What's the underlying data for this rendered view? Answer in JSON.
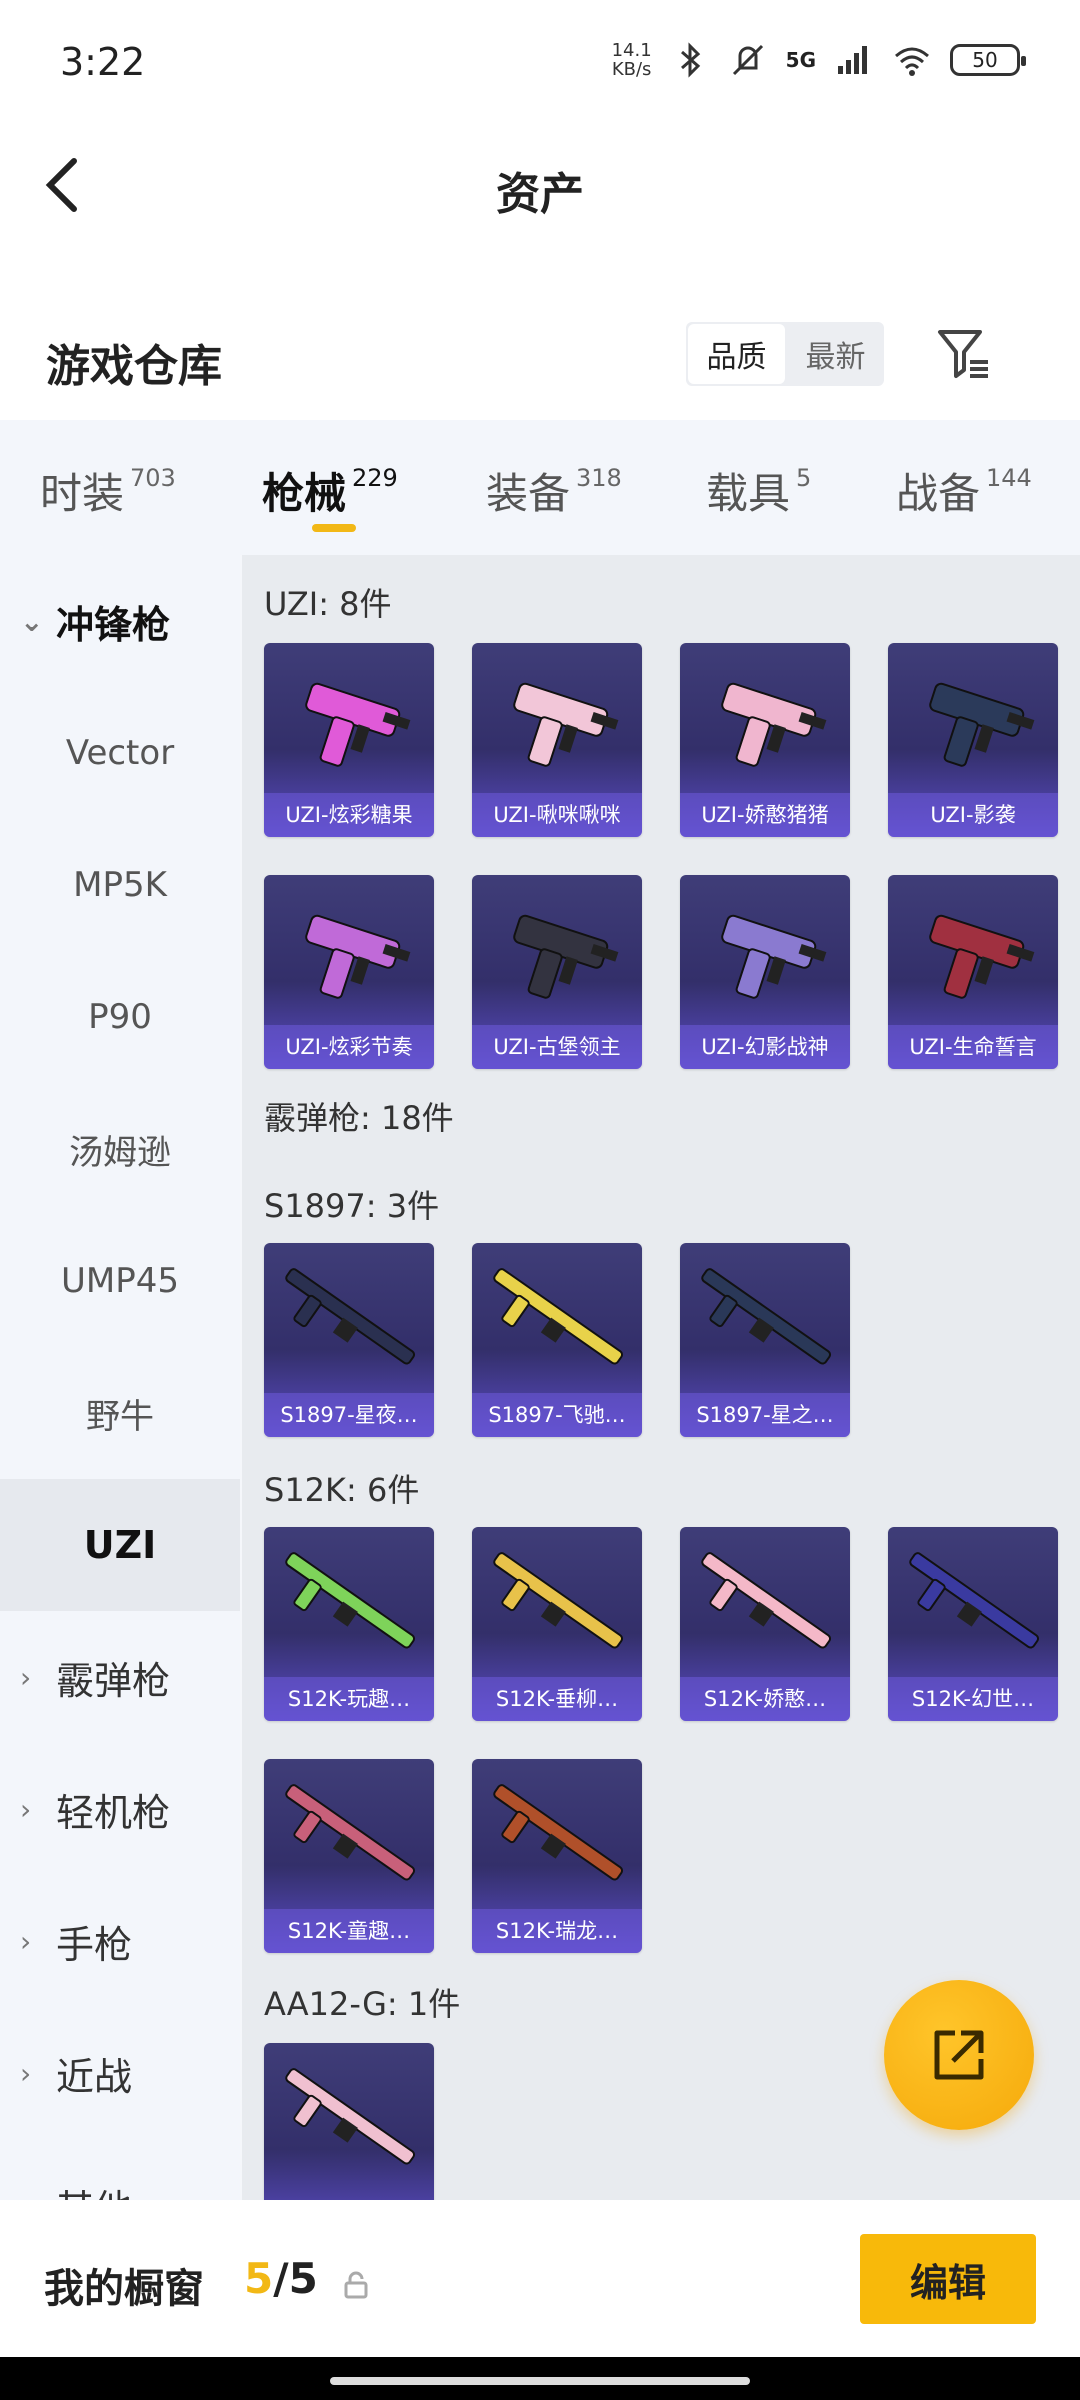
{
  "status": {
    "time": "3:22",
    "net_speed_top": "14.1",
    "net_speed_bottom": "KB/s",
    "network": "5G",
    "battery": "50"
  },
  "header": {
    "title": "资产"
  },
  "warehouse": {
    "title": "游戏仓库",
    "sort_options": [
      "品质",
      "最新"
    ]
  },
  "tabs": [
    {
      "label": "时装",
      "count": "703"
    },
    {
      "label": "枪械",
      "count": "229"
    },
    {
      "label": "装备",
      "count": "318"
    },
    {
      "label": "载具",
      "count": "5"
    },
    {
      "label": "战备",
      "count": "144"
    }
  ],
  "sidebar": {
    "expanded_category": "冲锋枪",
    "subitems": [
      "Vector",
      "MP5K",
      "P90",
      "汤姆逊",
      "UMP45",
      "野牛",
      "UZI"
    ],
    "categories": [
      "霰弹枪",
      "轻机枪",
      "手枪",
      "近战",
      "其他"
    ]
  },
  "content": {
    "uzi_title": "UZI: 8件",
    "uzi_items": [
      "UZI-炫彩糖果",
      "UZI-啾咪啾咪",
      "UZI-娇憨猪猪",
      "UZI-影袭",
      "UZI-炫彩节奏",
      "UZI-古堡领主",
      "UZI-幻影战神",
      "UZI-生命誓言"
    ],
    "shotgun_title": "霰弹枪: 18件",
    "s1897_title": "S1897: 3件",
    "s1897_items": [
      "S1897-星夜…",
      "S1897-飞驰…",
      "S1897-星之…"
    ],
    "s12k_title": "S12K: 6件",
    "s12k_items": [
      "S12K-玩趣…",
      "S12K-垂柳…",
      "S12K-娇憨…",
      "S12K-幻世…",
      "S12K-童趣…",
      "S12K-瑞龙…"
    ],
    "aa12_title": "AA12-G: 1件"
  },
  "footer": {
    "showcase_label": "我的橱窗",
    "showcase_current": "5",
    "showcase_total": "/5",
    "edit_label": "编辑"
  },
  "colors": {
    "accent": "#f2b816",
    "card_bg": "#3f3d78",
    "caption_bg": "#6e5adc"
  }
}
